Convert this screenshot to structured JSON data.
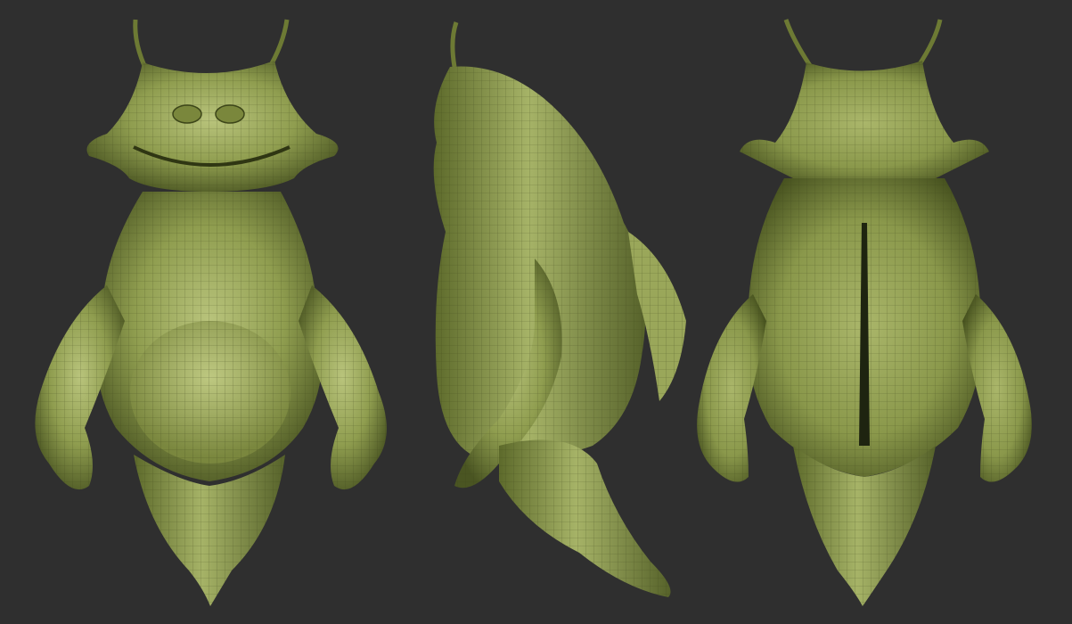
{
  "scene": {
    "background": "#2f2f2f",
    "subject": "green-creature-sculpt-wireframe",
    "views": [
      {
        "id": "front",
        "label": ""
      },
      {
        "id": "side",
        "label": ""
      },
      {
        "id": "back",
        "label": ""
      }
    ]
  },
  "colors": {
    "skin_light": "#b7c27a",
    "skin_mid": "#8f9d4f",
    "skin_dark": "#4f5a24",
    "skin_shadow": "#2d3414",
    "wire": "#3a4219"
  }
}
